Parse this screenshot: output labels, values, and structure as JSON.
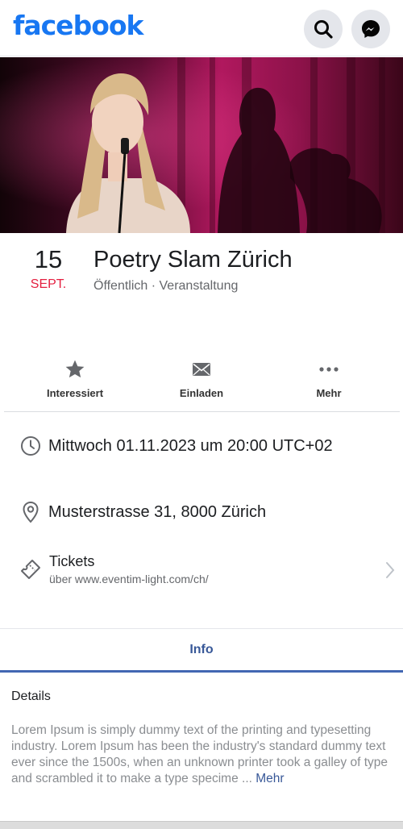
{
  "header": {
    "logo_text": "facebook",
    "brand_color": "#1877f2",
    "icons": [
      "search-icon",
      "messenger-icon"
    ]
  },
  "cover": {
    "icon": "cover-photo",
    "accent_color": "#b0185e"
  },
  "event": {
    "day": "15",
    "month": "SEPT.",
    "month_color": "#e41e3f",
    "title": "Poetry Slam Zürich",
    "subtitle": "Öffentlich · Veranstaltung"
  },
  "actions": [
    {
      "label": "Interessiert",
      "icon": "star-icon"
    },
    {
      "label": "Einladen",
      "icon": "envelope-icon"
    },
    {
      "label": "Mehr",
      "icon": "more-dots-icon"
    }
  ],
  "info": {
    "datetime": "Mittwoch 01.11.2023 um 20:00 UTC+02",
    "datetime_icon": "clock-icon",
    "address": "Musterstrasse 31, 8000 Zürich",
    "address_icon": "location-pin-icon"
  },
  "tickets": {
    "title": "Tickets",
    "subtitle": "über www.eventim-light.com/ch/",
    "icon": "ticket-icon"
  },
  "tabs": {
    "active_label": "Info",
    "active_color": "#385898"
  },
  "details": {
    "title": "Details",
    "text": "Lorem Ipsum is simply dummy text of the printing and typesetting industry. Lorem Ipsum has been the industry's standard dummy text ever since the 1500s, when an unknown printer took a galley of type and scrambled it to make a type specime ...",
    "more_label": "Mehr"
  }
}
